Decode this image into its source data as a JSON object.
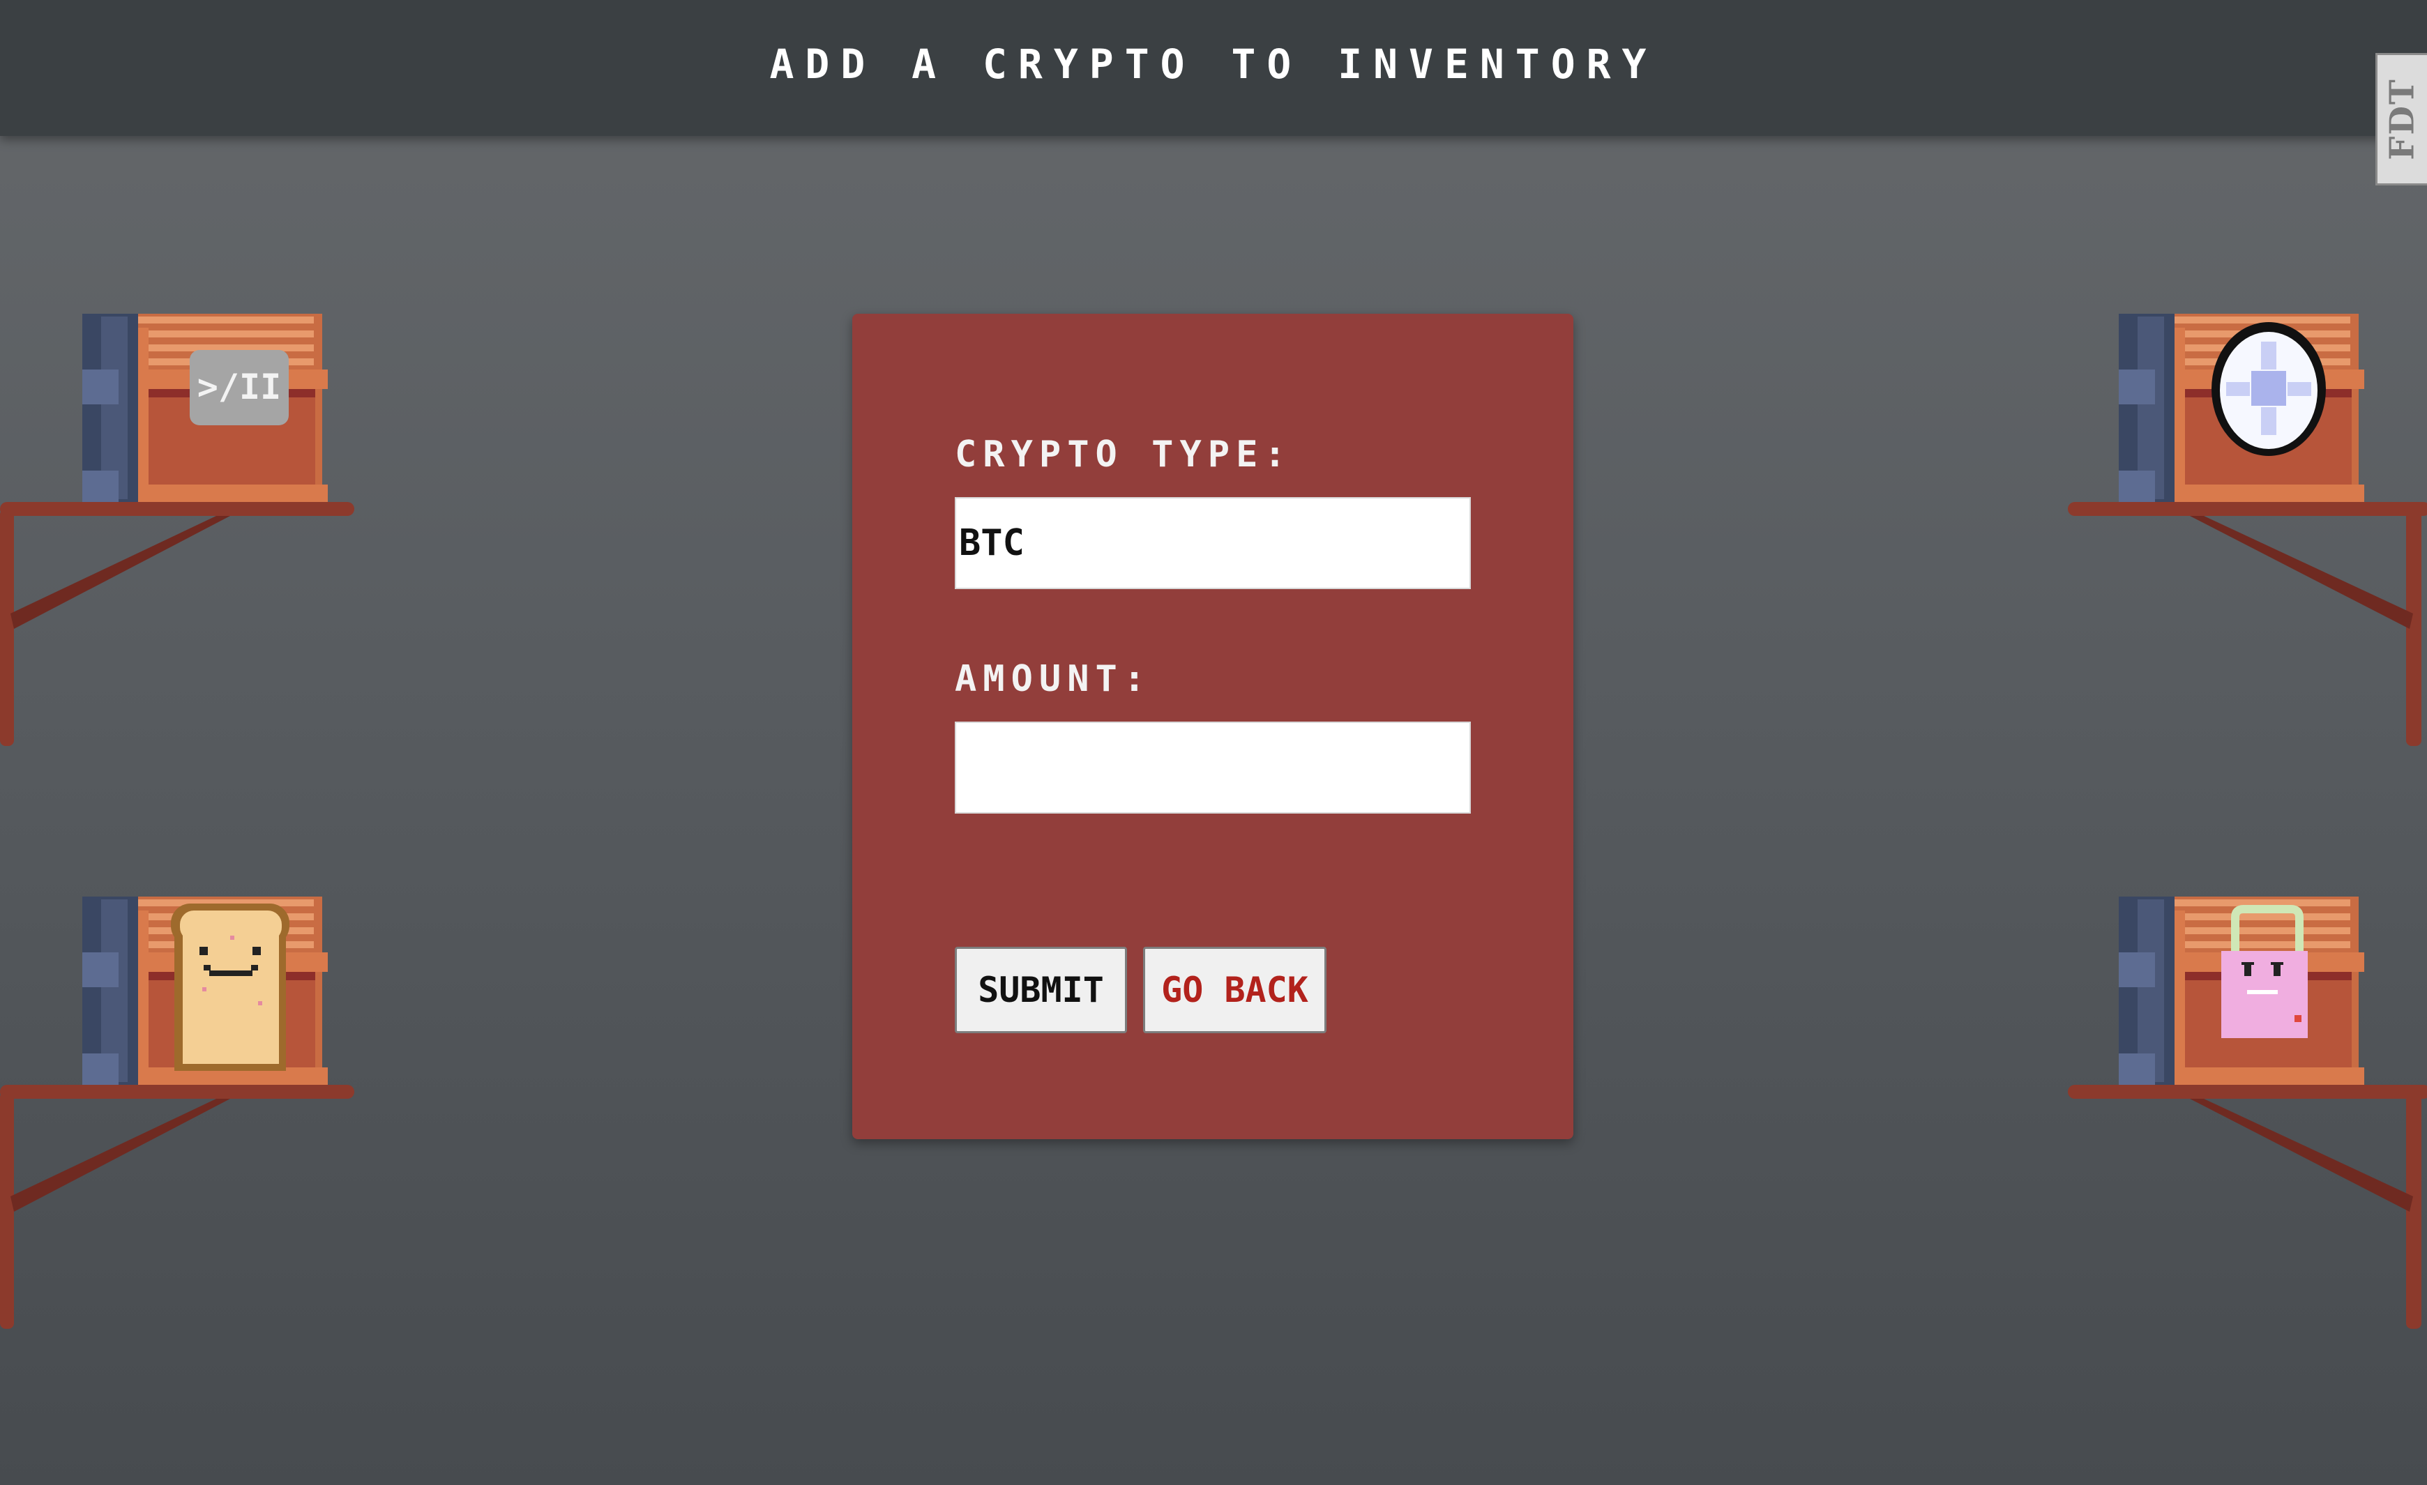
{
  "header": {
    "title": "ADD A CRYPTO TO INVENTORY"
  },
  "badge": {
    "text": "FDT"
  },
  "form": {
    "crypto_type_label": "CRYPTO TYPE:",
    "crypto_type_value": "BTC",
    "amount_label": "AMOUNT:",
    "amount_value": "",
    "submit_label": "SUBMIT",
    "back_label": "GO BACK"
  },
  "decor": {
    "play_pause_text": ">/II"
  },
  "colors": {
    "header_bg": "#3b4043",
    "card_bg": "#923e3b",
    "back_text": "#b2221c",
    "shelf_wood": "#8c3a2c",
    "chest": "#d97a4c"
  }
}
